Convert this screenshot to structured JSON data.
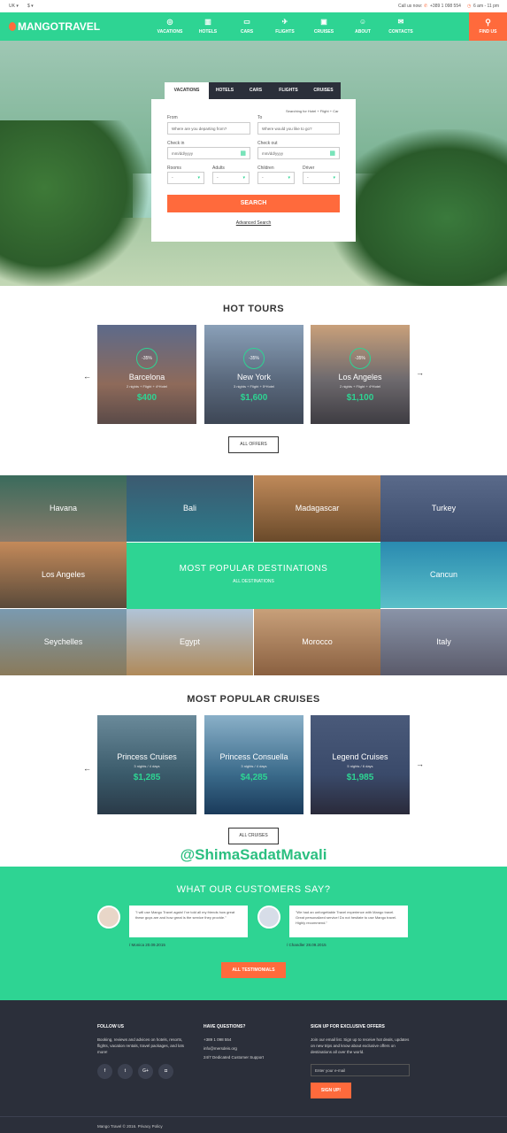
{
  "topbar": {
    "locale": "UK",
    "currency": "$",
    "call_label": "Call us now:",
    "phone": "+389 1 098 554",
    "hours": "6 am - 11 pm"
  },
  "nav": {
    "brand": "MANGOTRAVEL",
    "items": [
      {
        "label": "VACATIONS",
        "icon": "globe-icon",
        "glyph": "◎"
      },
      {
        "label": "HOTELS",
        "icon": "hotel-icon",
        "glyph": "▥"
      },
      {
        "label": "CARS",
        "icon": "car-icon",
        "glyph": "▭"
      },
      {
        "label": "FLIGHTS",
        "icon": "plane-icon",
        "glyph": "✈"
      },
      {
        "label": "CRUISES",
        "icon": "suitcase-icon",
        "glyph": "▣"
      },
      {
        "label": "ABOUT",
        "icon": "people-icon",
        "glyph": "☺"
      },
      {
        "label": "CONTACTS",
        "icon": "mail-icon",
        "glyph": "✉"
      }
    ],
    "find_us": "FIND US",
    "find_us_icon": "map-pin-icon",
    "accent": "#2ed493",
    "orange": "#ff6a3c"
  },
  "search": {
    "tabs": [
      "VACATIONS",
      "HOTELS",
      "CARS",
      "FLIGHTS",
      "CRUISES"
    ],
    "note": "Searching for Hotel + Flight + Car",
    "from_label": "From",
    "from_placeholder": "Where are you departing from?",
    "to_label": "To",
    "to_placeholder": "Where would you like to go?",
    "checkin_label": "Check in",
    "checkin_placeholder": "mm/dd/yyyy",
    "checkout_label": "Check out",
    "checkout_placeholder": "mm/dd/yyyy",
    "rooms_label": "Rooms",
    "adults_label": "Adults",
    "children_label": "Children",
    "driver_label": "Driver",
    "select_value": "-",
    "button": "SEARCH",
    "advanced": "Advanced Search"
  },
  "hot_tours": {
    "title": "HOT TOURS",
    "items": [
      {
        "badge": "-35%",
        "name": "Barcelona",
        "details": "2 nights + Flight + 4*Hotel",
        "price": "$400"
      },
      {
        "badge": "-35%",
        "name": "New York",
        "details": "3 nights + Flight + 5*Hotel",
        "price": "$1,600"
      },
      {
        "badge": "-35%",
        "name": "Los Angeles",
        "details": "2 nights + Flight + 4*Hotel",
        "price": "$1,100"
      }
    ],
    "button": "ALL OFFERS"
  },
  "destinations": {
    "row1": [
      "Havana",
      "Bali",
      "Madagascar",
      "Turkey"
    ],
    "row2_left": "Los Angeles",
    "row2_right": "Cancun",
    "row3": [
      "Seychelles",
      "Egypt",
      "Morocco",
      "Italy"
    ],
    "title": "MOST POPULAR DESTINATIONS",
    "link": "ALL DESTINATIONS"
  },
  "cruises": {
    "title": "MOST POPULAR CRUISES",
    "items": [
      {
        "name": "Princess Cruises",
        "details": "3 nights / 4 days",
        "price": "$1,285"
      },
      {
        "name": "Princess Consuella",
        "details": "3 nights / 4 days",
        "price": "$4,285"
      },
      {
        "name": "Legend Cruises",
        "details": "5 nights / 6 days",
        "price": "$1,985"
      }
    ],
    "button": "ALL CRUISES"
  },
  "watermark": "@ShimaSadatMavali",
  "testimonials": {
    "title": "WHAT OUR CUSTOMERS SAY?",
    "items": [
      {
        "quote": "\"I will use Mango Travel again! I've told all my friends how great these guys are and how great is the service they provide.\"",
        "author": "Monica",
        "date": "20.09.2015"
      },
      {
        "quote": "\"We had an unforgettable Travel experience with Mango travel. Great personalized service! Do not hesitate to use Mango travel. Highly recommend.\"",
        "author": "Chandler",
        "date": "28.09.2015"
      }
    ],
    "button": "ALL TESTIMONIALS"
  },
  "footer": {
    "follow_title": "FOLLOW US",
    "follow_text": "Booking, reviews and advices on hotels, resorts, flights, vacation rentals, travel packages, and lots more!",
    "social": [
      {
        "icon": "facebook-icon",
        "glyph": "f"
      },
      {
        "icon": "twitter-icon",
        "glyph": "t"
      },
      {
        "icon": "google-plus-icon",
        "glyph": "G+"
      },
      {
        "icon": "instagram-icon",
        "glyph": "◘"
      }
    ],
    "questions_title": "HAVE QUESTIONS?",
    "phone": "+389 1 098 554",
    "email": "info@mersdeis.org",
    "support": "24/7 Dedicated Customer Support",
    "signup_title": "SIGN UP FOR EXCLUSIVE OFFERS",
    "signup_text": "Join our email list. Sign up to receive hot deals, updates on new trips and know about exclusive offers on destinations all over the world.",
    "email_placeholder": "Enter your e-mail",
    "signup_button": "SIGN UP!",
    "copyright": "Mango Travel © 2016. Privacy Policy"
  }
}
